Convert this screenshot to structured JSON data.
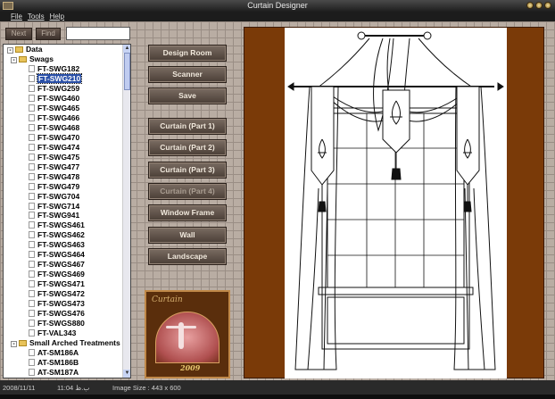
{
  "window": {
    "title": "Curtain Designer"
  },
  "menu": {
    "file": "File",
    "tools": "Tools",
    "help": "Help"
  },
  "toolbar": {
    "next_label": "Next",
    "find_label": "Find",
    "search_value": ""
  },
  "tree": {
    "root": "Data",
    "swags_label": "Swags",
    "swags": [
      "FT-SWG182",
      "FT-SWG210",
      "FT-SWG259",
      "FT-SWG460",
      "FT-SWG465",
      "FT-SWG466",
      "FT-SWG468",
      "FT-SWG470",
      "FT-SWG474",
      "FT-SWG475",
      "FT-SWG477",
      "FT-SWG478",
      "FT-SWG479",
      "FT-SWG704",
      "FT-SWG714",
      "FT-SWG941",
      "FT-SWGS461",
      "FT-SWGS462",
      "FT-SWGS463",
      "FT-SWGS464",
      "FT-SWGS467",
      "FT-SWGS469",
      "FT-SWGS471",
      "FT-SWGS472",
      "FT-SWGS473",
      "FT-SWGS476",
      "FT-SWGS880",
      "FT-VAL343"
    ],
    "selected": "FT-SWG210",
    "arched_label": "Small Arched Treatments",
    "arched": [
      "AT-SM186A",
      "AT-SM186B",
      "AT-SM187A"
    ]
  },
  "actions": {
    "design_room": "Design Room",
    "scanner": "Scanner",
    "save": "Save",
    "curtain1": "Curtain (Part 1)",
    "curtain2": "Curtain (Part 2)",
    "curtain3": "Curtain (Part 3)",
    "curtain4": "Curtain (Part 4)",
    "window_frame": "Window Frame",
    "wall": "Wall",
    "landscape": "Landscape"
  },
  "logo": {
    "script": "Curtain",
    "year": "2009"
  },
  "status": {
    "date": "2008/11/11",
    "time": "11:04 ب.ظ",
    "image_size": "Image Size : 443 x 600"
  },
  "colors": {
    "frame_brown": "#7a3a08",
    "selected_blue": "#2a50a8"
  }
}
